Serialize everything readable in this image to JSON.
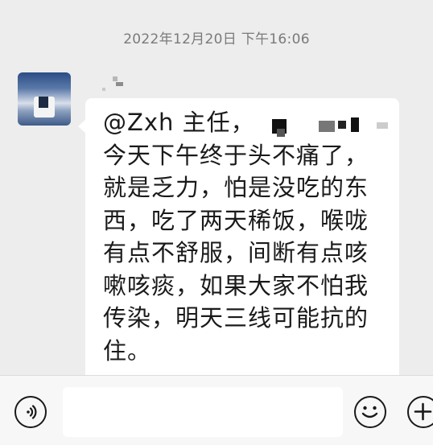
{
  "chat": {
    "timestamp": "2022年12月20日 下午16:06",
    "message": {
      "lines": [
        "@Zxh 主任，",
        "今天下午终于头不痛了，",
        "就是乏力，怕是没吃的东",
        "西，吃了两天稀饭，喉咙",
        "有点不舒服，间断有点咳",
        "嗽咳痰，如果大家不怕我",
        "传染，明天三线可能抗的",
        "住。"
      ]
    }
  },
  "input_bar": {
    "voice_icon": "voice-icon",
    "emoji_icon": "emoji-icon",
    "plus_icon": "plus-icon",
    "input_value": ""
  },
  "colors": {
    "chat_background": "#ededed",
    "bubble": "#ffffff",
    "timestamp_text": "#7a7a7a",
    "message_text": "#1a1a1a"
  }
}
